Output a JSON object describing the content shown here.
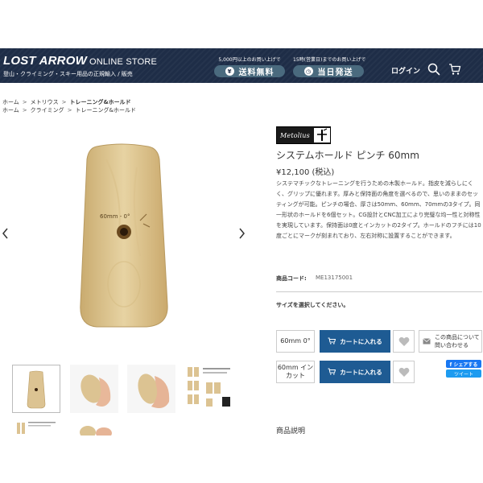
{
  "header": {
    "logo_main": "LOST ARROW",
    "logo_sub": "ONLINE STORE",
    "tagline": "登山・クライミング・スキー用品の正規輸入 / 販売",
    "promo1": {
      "small": "5,000円以上のお買い上げで",
      "pill": "送料無料",
      "coin": "¥"
    },
    "promo2": {
      "small": "15時(営業日)までのお買い上げで",
      "pill": "当日発送",
      "coin": "◷"
    },
    "login": "ログイン",
    "search_icon": "search-icon",
    "cart_icon": "cart-icon"
  },
  "breadcrumb1": [
    "ホーム",
    "メトリウス",
    "トレーニング&ホールド"
  ],
  "breadcrumb2": [
    "ホーム",
    "クライミング",
    "トレーニング&ホールド"
  ],
  "breadcrumb_separator": ">",
  "gallery": {
    "main_label": "60mm - 0°",
    "prev_icon": "chevron-left-icon",
    "next_icon": "chevron-right-icon"
  },
  "product": {
    "brand": "Metolius",
    "title": "システムホールド ピンチ 60mm",
    "price": "¥12,100 (税込)",
    "description": "システマチックなトレーニングを行うための木製ホールド。指皮を減らしにくく、グリップに優れます。厚みと保持面の角度を選べるので、思いのままのセッティングが可能。ピンチの場合、厚さは50mm、60mm、70mmの3タイプ。同一形状のホールドを6個セット。CG設計とCNC加工により完璧な均一性と対称性を実現しています。保持面は0度とインカットの2タイプ。ホールドのフチには10度ごとにマークが刻まれており、左右対称に設置することができます。",
    "code_label": "商品コード:",
    "code_value": "ME13175001",
    "size_prompt": "サイズを選択してください。",
    "variants": [
      {
        "label": "60mm 0°",
        "cart": "カートに入れる"
      },
      {
        "label": "60mm インカット",
        "cart": "カートに入れる"
      }
    ],
    "contact": "この商品について 問い合わせる",
    "share_fb": "f シェアする",
    "share_tw": "ツイート",
    "section_title": "商品説明"
  },
  "colors": {
    "header_bg": "#1e2d47",
    "cart_button": "#1e5b93",
    "pill": "#4a6a7e",
    "facebook": "#1877f2",
    "twitter": "#1d9bf0"
  }
}
